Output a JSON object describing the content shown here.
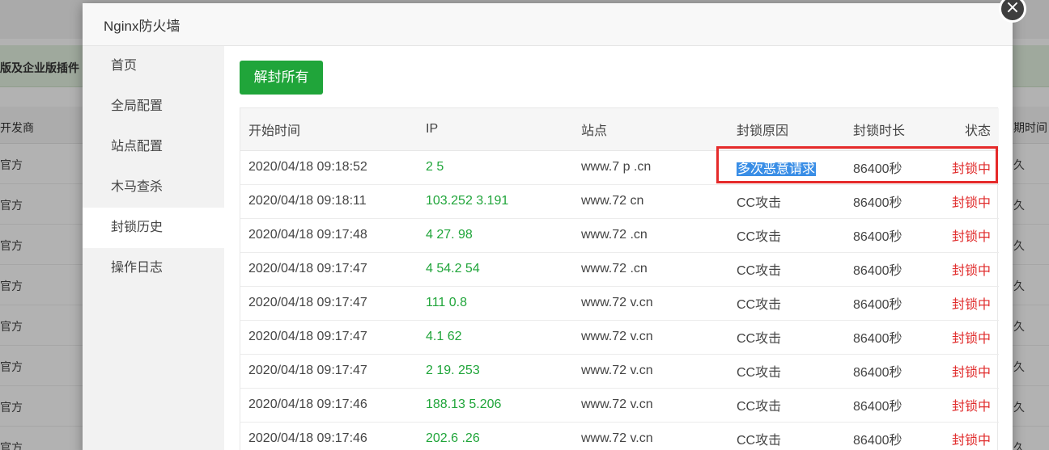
{
  "background": {
    "banner_text": "版及企业版插件",
    "header_left": "开发商",
    "header_right": "期时间",
    "row_left": "官方",
    "row_right": "久"
  },
  "modal": {
    "title": "Nginx防火墙",
    "close_icon": "×"
  },
  "sidebar": {
    "items": [
      {
        "label": "首页"
      },
      {
        "label": "全局配置"
      },
      {
        "label": "站点配置"
      },
      {
        "label": "木马查杀"
      },
      {
        "label": "封锁历史"
      },
      {
        "label": "操作日志"
      }
    ],
    "active_index": 4
  },
  "toolbar": {
    "unblock_all_label": "解封所有"
  },
  "table": {
    "columns": [
      "开始时间",
      "IP",
      "站点",
      "封锁原因",
      "封锁时长",
      "状态"
    ],
    "rows": [
      {
        "time": "2020/04/18 09:18:52",
        "ip": "2      5",
        "site": "www.7     p    .cn",
        "reason": "多次恶意请求",
        "duration": "86400秒",
        "status": "封锁中"
      },
      {
        "time": "2020/04/18 09:18:11",
        "ip": "103.252     3.191",
        "site": "www.72         cn",
        "reason": "CC攻击",
        "duration": "86400秒",
        "status": "封锁中"
      },
      {
        "time": "2020/04/18 09:17:48",
        "ip": "4   27.     98",
        "site": "www.72        .cn",
        "reason": "CC攻击",
        "duration": "86400秒",
        "status": "封锁中"
      },
      {
        "time": "2020/04/18 09:17:47",
        "ip": "4   54.2     54",
        "site": "www.72         .cn",
        "reason": "CC攻击",
        "duration": "86400秒",
        "status": "封锁中"
      },
      {
        "time": "2020/04/18 09:17:47",
        "ip": "   111     0.8",
        "site": "www.72       v.cn",
        "reason": "CC攻击",
        "duration": "86400秒",
        "status": "封锁中"
      },
      {
        "time": "2020/04/18 09:17:47",
        "ip": "   4.1     62",
        "site": "www.72       v.cn",
        "reason": "CC攻击",
        "duration": "86400秒",
        "status": "封锁中"
      },
      {
        "time": "2020/04/18 09:17:47",
        "ip": "2   19.     253",
        "site": "www.72       v.cn",
        "reason": "CC攻击",
        "duration": "86400秒",
        "status": "封锁中"
      },
      {
        "time": "2020/04/18 09:17:46",
        "ip": "188.13     5.206",
        "site": "www.72       v.cn",
        "reason": "CC攻击",
        "duration": "86400秒",
        "status": "封锁中"
      },
      {
        "time": "2020/04/18 09:17:46",
        "ip": "202.6      .26",
        "site": "www.72       v.cn",
        "reason": "CC攻击",
        "duration": "86400秒",
        "status": "封锁中"
      }
    ]
  },
  "colors": {
    "primary_green": "#20a53a",
    "status_red": "#e02d2d",
    "highlight_blue": "#3a8ee6",
    "annotation_red": "#e52a2a"
  }
}
